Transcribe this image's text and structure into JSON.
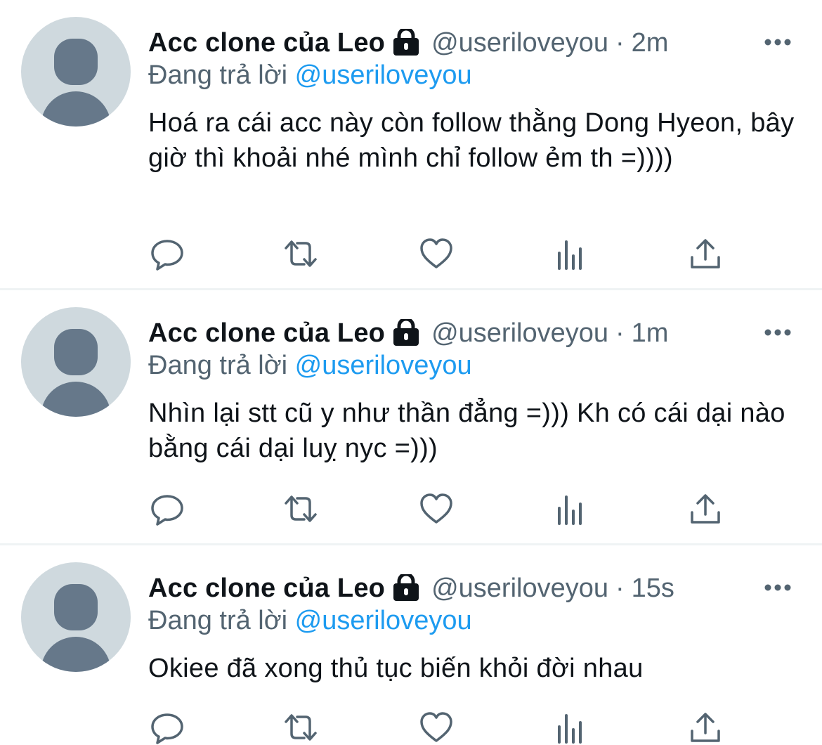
{
  "colors": {
    "name": "#0f1419",
    "muted": "#536471",
    "mention": "#1d9bf0",
    "avatar_bg": "#cfd9de",
    "avatar_fg": "#66788a",
    "separator": "#eff3f4"
  },
  "tweets": [
    {
      "display_name": "Acc clone của Leo",
      "handle": "@useriloveyou",
      "separator": "·",
      "time": "2m",
      "reply_prefix": "Đang trả lời",
      "reply_to": "@useriloveyou",
      "text": "Hoá ra cái acc này còn follow thằng Dong Hyeon, bây giờ thì khoải nhé mình chỉ follow ẻm th =))))",
      "icons": [
        "lock-icon",
        "more-icon",
        "reply-icon",
        "retweet-icon",
        "like-icon",
        "views-icon",
        "share-icon"
      ]
    },
    {
      "display_name": "Acc clone của Leo",
      "handle": "@useriloveyou",
      "separator": "·",
      "time": "1m",
      "reply_prefix": "Đang trả lời",
      "reply_to": "@useriloveyou",
      "text": "Nhìn lại stt cũ y như thần đẳng =))) Kh có cái dại nào bằng cái dại luỵ nyc =)))",
      "icons": [
        "lock-icon",
        "more-icon",
        "reply-icon",
        "retweet-icon",
        "like-icon",
        "views-icon",
        "share-icon"
      ]
    },
    {
      "display_name": "Acc clone của Leo",
      "handle": "@useriloveyou",
      "separator": "·",
      "time": "15s",
      "reply_prefix": "Đang trả lời",
      "reply_to": "@useriloveyou",
      "text": "Okiee đã xong thủ tục biến khỏi đời nhau",
      "icons": [
        "lock-icon",
        "more-icon",
        "reply-icon",
        "retweet-icon",
        "like-icon",
        "views-icon",
        "share-icon"
      ]
    }
  ]
}
